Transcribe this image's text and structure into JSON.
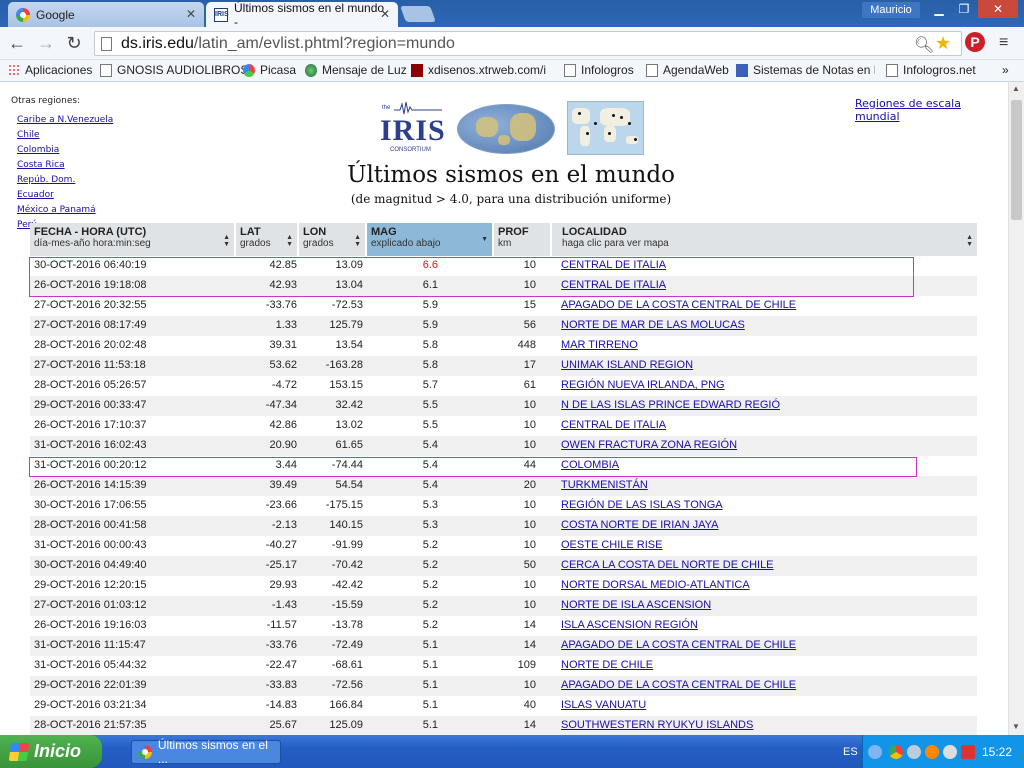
{
  "browser": {
    "tabs": [
      {
        "label": "Google"
      },
      {
        "label": "Últimos sismos en el mundo -"
      }
    ],
    "user": "Mauricio",
    "url_host": "ds.iris.edu",
    "url_path": "/latin_am/evlist.phtml?region=mundo"
  },
  "bookmarks": [
    {
      "label": "Aplicaciones",
      "icon": "apps-icon"
    },
    {
      "label": "GNOSIS AUDIOLIBROS",
      "icon": "page-icon"
    },
    {
      "label": "Picasa",
      "icon": "picasa-icon"
    },
    {
      "label": "Mensaje de Luz",
      "icon": "globe-icon"
    },
    {
      "label": "xdisenos.xtrweb.com/in",
      "icon": "x-icon"
    },
    {
      "label": "Infologros",
      "icon": "page-icon"
    },
    {
      "label": "AgendaWeb",
      "icon": "page-icon"
    },
    {
      "label": "Sistemas de Notas en Lí",
      "icon": "notes-icon"
    },
    {
      "label": "Infologros.net",
      "icon": "page-icon"
    }
  ],
  "page": {
    "other_regions_label": "Otras regiones:",
    "regions": [
      "Caribe a N.Venezuela",
      "Chile",
      "Colombia",
      "Costa Rica",
      "Repúb. Dom.",
      "Ecuador",
      "México a Panamá",
      "Perú"
    ],
    "world_scale_link": "Regiones de escala mundial",
    "logo_word": "IRIS",
    "logo_top": "the",
    "logo_bottom": "CONSORTIUM",
    "title": "Últimos sismos en el mundo",
    "subtitle": "(de magnitud > 4.0, para una distribución uniforme)"
  },
  "table": {
    "headers": [
      {
        "title": "FECHA - HORA (UTC)",
        "sub": "día-mes-año hora:min:seg"
      },
      {
        "title": "LAT",
        "sub": "grados"
      },
      {
        "title": "LON",
        "sub": "grados"
      },
      {
        "title": "MAG",
        "sub": "explicado abajo"
      },
      {
        "title": "PROF",
        "sub": "km"
      },
      {
        "title": "LOCALIDAD",
        "sub": "haga clic para ver mapa"
      }
    ],
    "rows": [
      {
        "date": "30-OCT-2016 06:40:19",
        "lat": "42.85",
        "lon": "13.09",
        "mag": "6.6",
        "prof": "10",
        "loc": "CENTRAL DE ITALIA"
      },
      {
        "date": "26-OCT-2016 19:18:08",
        "lat": "42.93",
        "lon": "13.04",
        "mag": "6.1",
        "prof": "10",
        "loc": "CENTRAL DE ITALIA"
      },
      {
        "date": "27-OCT-2016 20:32:55",
        "lat": "-33.76",
        "lon": "-72.53",
        "mag": "5.9",
        "prof": "15",
        "loc": "APAGADO DE LA COSTA CENTRAL DE CHILE"
      },
      {
        "date": "27-OCT-2016 08:17:49",
        "lat": "1.33",
        "lon": "125.79",
        "mag": "5.9",
        "prof": "56",
        "loc": "NORTE DE MAR DE LAS MOLUCAS"
      },
      {
        "date": "28-OCT-2016 20:02:48",
        "lat": "39.31",
        "lon": "13.54",
        "mag": "5.8",
        "prof": "448",
        "loc": "MAR TIRRENO"
      },
      {
        "date": "27-OCT-2016 11:53:18",
        "lat": "53.62",
        "lon": "-163.28",
        "mag": "5.8",
        "prof": "17",
        "loc": "UNIMAK ISLAND REGION"
      },
      {
        "date": "28-OCT-2016 05:26:57",
        "lat": "-4.72",
        "lon": "153.15",
        "mag": "5.7",
        "prof": "61",
        "loc": "REGIÓN NUEVA IRLANDA, PNG"
      },
      {
        "date": "29-OCT-2016 00:33:47",
        "lat": "-47.34",
        "lon": "32.42",
        "mag": "5.5",
        "prof": "10",
        "loc": "N DE LAS ISLAS PRINCE EDWARD REGIÓ"
      },
      {
        "date": "26-OCT-2016 17:10:37",
        "lat": "42.86",
        "lon": "13.02",
        "mag": "5.5",
        "prof": "10",
        "loc": "CENTRAL DE ITALIA"
      },
      {
        "date": "31-OCT-2016 16:02:43",
        "lat": "20.90",
        "lon": "61.65",
        "mag": "5.4",
        "prof": "10",
        "loc": "OWEN FRACTURA ZONA REGIÓN"
      },
      {
        "date": "31-OCT-2016 00:20:12",
        "lat": "3.44",
        "lon": "-74.44",
        "mag": "5.4",
        "prof": "44",
        "loc": "COLOMBIA"
      },
      {
        "date": "26-OCT-2016 14:15:39",
        "lat": "39.49",
        "lon": "54.54",
        "mag": "5.4",
        "prof": "20",
        "loc": "TURKMENISTÁN"
      },
      {
        "date": "30-OCT-2016 17:06:55",
        "lat": "-23.66",
        "lon": "-175.15",
        "mag": "5.3",
        "prof": "10",
        "loc": "REGIÓN DE LAS ISLAS TONGA"
      },
      {
        "date": "28-OCT-2016 00:41:58",
        "lat": "-2.13",
        "lon": "140.15",
        "mag": "5.3",
        "prof": "10",
        "loc": "COSTA NORTE DE IRIAN JAYA"
      },
      {
        "date": "31-OCT-2016 00:00:43",
        "lat": "-40.27",
        "lon": "-91.99",
        "mag": "5.2",
        "prof": "10",
        "loc": "OESTE CHILE RISE"
      },
      {
        "date": "30-OCT-2016 04:49:40",
        "lat": "-25.17",
        "lon": "-70.42",
        "mag": "5.2",
        "prof": "50",
        "loc": "CERCA LA COSTA DEL NORTE DE CHILE"
      },
      {
        "date": "29-OCT-2016 12:20:15",
        "lat": "29.93",
        "lon": "-42.42",
        "mag": "5.2",
        "prof": "10",
        "loc": "NORTE DORSAL MEDIO-ATLANTICA"
      },
      {
        "date": "27-OCT-2016 01:03:12",
        "lat": "-1.43",
        "lon": "-15.59",
        "mag": "5.2",
        "prof": "10",
        "loc": "NORTE DE ISLA ASCENSION"
      },
      {
        "date": "26-OCT-2016 19:16:03",
        "lat": "-11.57",
        "lon": "-13.78",
        "mag": "5.2",
        "prof": "14",
        "loc": "ISLA ASCENSION REGIÓN"
      },
      {
        "date": "31-OCT-2016 11:15:47",
        "lat": "-33.76",
        "lon": "-72.49",
        "mag": "5.1",
        "prof": "14",
        "loc": "APAGADO DE LA COSTA CENTRAL DE CHILE"
      },
      {
        "date": "31-OCT-2016 05:44:32",
        "lat": "-22.47",
        "lon": "-68.61",
        "mag": "5.1",
        "prof": "109",
        "loc": "NORTE DE CHILE"
      },
      {
        "date": "29-OCT-2016 22:01:39",
        "lat": "-33.83",
        "lon": "-72.56",
        "mag": "5.1",
        "prof": "10",
        "loc": "APAGADO DE LA COSTA CENTRAL DE CHILE"
      },
      {
        "date": "29-OCT-2016 03:21:34",
        "lat": "-14.83",
        "lon": "166.84",
        "mag": "5.1",
        "prof": "40",
        "loc": "ISLAS VANUATU"
      },
      {
        "date": "28-OCT-2016 21:57:35",
        "lat": "25.67",
        "lon": "125.09",
        "mag": "5.1",
        "prof": "14",
        "loc": "SOUTHWESTERN RYUKYU ISLANDS"
      }
    ]
  },
  "taskbar": {
    "start_label": "Inicio",
    "task_label": "Últimos sismos en el ...",
    "lang": "ES",
    "clock": "15:22"
  },
  "colors": {
    "highlight_mag": "#d81818",
    "highlight_box": "#cc33cc",
    "active_header": "#8db8d8"
  }
}
